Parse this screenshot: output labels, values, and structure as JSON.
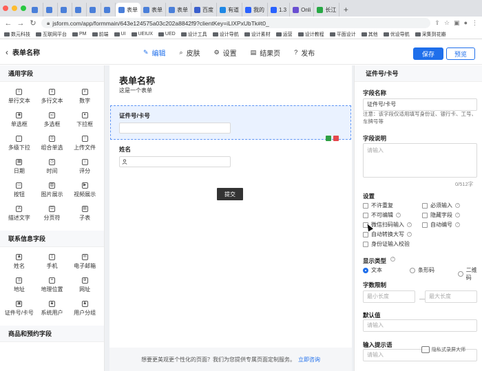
{
  "browser": {
    "tabs": [
      {
        "label": "",
        "color": "#4a7fd9"
      },
      {
        "label": "",
        "color": "#4a7fd9"
      },
      {
        "label": "",
        "color": "#4a7fd9"
      },
      {
        "label": "",
        "color": "#4a7fd9"
      },
      {
        "label": "",
        "color": "#4a7fd9"
      },
      {
        "label": "",
        "color": "#4a7fd9"
      },
      {
        "label": "表单",
        "color": "#4a7fd9",
        "active": true
      },
      {
        "label": "表单",
        "color": "#4a7fd9"
      },
      {
        "label": "表单",
        "color": "#4a7fd9"
      },
      {
        "label": "百度",
        "color": "#3a5fcd"
      },
      {
        "label": "有道",
        "color": "#1e88e5"
      },
      {
        "label": "我的",
        "color": "#2962ff"
      },
      {
        "label": "1.3",
        "color": "#2962ff"
      },
      {
        "label": "Onli",
        "color": "#6a4fd1"
      },
      {
        "label": "长江",
        "color": "#27a844"
      }
    ],
    "url": "jsform.com/app/formmain/643e124575a03c202a8842f9?clientKey=iLIXPxUbTk#t0_",
    "bookmarks": [
      "数元科技",
      "互联网平台",
      "PM",
      "前端",
      "UI",
      "UEIUX",
      "UED",
      "设计工具",
      "设计导航",
      "设计素材",
      "运营",
      "设计教程",
      "平面设计",
      "其他",
      "优设导航",
      "采集到花瓣"
    ]
  },
  "header": {
    "title": "表单名称",
    "tabs": [
      {
        "label": "编辑",
        "glyph": "✎",
        "active": true
      },
      {
        "label": "皮肤",
        "glyph": "⌕"
      },
      {
        "label": "设置",
        "glyph": "⚙"
      },
      {
        "label": "结果页",
        "glyph": "▤"
      },
      {
        "label": "发布",
        "glyph": "?"
      }
    ],
    "save": "保存",
    "preview": "预览"
  },
  "left": {
    "sections": [
      {
        "title": "通用字段",
        "items": [
          {
            "label": "单行文本",
            "icon": "T"
          },
          {
            "label": "多行文本",
            "icon": "≡"
          },
          {
            "label": "数字",
            "icon": "#"
          },
          {
            "label": "单选框",
            "icon": "◉"
          },
          {
            "label": "多选框",
            "icon": "☑"
          },
          {
            "label": "下拉框",
            "icon": "▾"
          },
          {
            "label": "多级下拉",
            "icon": "⋮"
          },
          {
            "label": "组合单选",
            "icon": "◎"
          },
          {
            "label": "上传文件",
            "icon": "↑"
          },
          {
            "label": "日期",
            "icon": "▦"
          },
          {
            "label": "时间",
            "icon": "◷"
          },
          {
            "label": "评分",
            "icon": "☆"
          },
          {
            "label": "按钮",
            "icon": "▭"
          },
          {
            "label": "图片展示",
            "icon": "▨"
          },
          {
            "label": "视频展示",
            "icon": "▶"
          },
          {
            "label": "描述文字",
            "icon": "A"
          },
          {
            "label": "分页符",
            "icon": "⊟"
          },
          {
            "label": "子表",
            "icon": "▤"
          }
        ]
      },
      {
        "title": "联系信息字段",
        "items": [
          {
            "label": "姓名",
            "icon": "♟"
          },
          {
            "label": "手机",
            "icon": "▯"
          },
          {
            "label": "电子邮箱",
            "icon": "✉"
          },
          {
            "label": "地址",
            "icon": "◎"
          },
          {
            "label": "地理位置",
            "icon": "⌖"
          },
          {
            "label": "网址",
            "icon": "⊕"
          },
          {
            "label": "证件号/卡号",
            "icon": "▣"
          },
          {
            "label": "系统用户",
            "icon": "♟"
          },
          {
            "label": "用户分组",
            "icon": "♟"
          }
        ]
      },
      {
        "title": "商品和预约字段",
        "items": []
      }
    ]
  },
  "canvas": {
    "form_title": "表单名称",
    "form_desc": "这是一个表单",
    "field1_label": "证件号/卡号",
    "field2_label": "姓名",
    "submit": "提交",
    "footer_text": "想要更美观更个性化的页面？我们为您提供专属页面定制服务。",
    "footer_link": "立即咨询"
  },
  "right": {
    "head": "证件号/卡号",
    "field_name_label": "字段名称",
    "field_name_value": "证件号/卡号",
    "note": "注意：该字段仅适用填写身份证、银行卡、工号、车牌号等",
    "desc_label": "字段说明",
    "desc_placeholder": "请输入",
    "counter": "0/512字",
    "settings_label": "设置",
    "settings": [
      {
        "label": "不许重复",
        "help": false
      },
      {
        "label": "必须输入",
        "help": true
      },
      {
        "label": "不可编辑",
        "help": true
      },
      {
        "label": "隐藏字段",
        "help": true
      },
      {
        "label": "微信扫码输入",
        "help": true
      },
      {
        "label": "自动编号",
        "help": true
      },
      {
        "label": "自动转换大写",
        "help": true
      },
      {
        "label": "身份证输入校验",
        "help": false
      }
    ],
    "display_label": "显示类型",
    "display_options": [
      {
        "label": "文本",
        "selected": true
      },
      {
        "label": "条形码",
        "selected": false
      },
      {
        "label": "二维码",
        "selected": false
      }
    ],
    "limit_label": "字数限制",
    "min_placeholder": "最小长度",
    "max_placeholder": "最大长度",
    "default_label": "默认值",
    "default_placeholder": "请输入",
    "hint_label": "输入提示语",
    "hint_placeholder": "请输入"
  },
  "watermark": "隐私式录屏大师"
}
